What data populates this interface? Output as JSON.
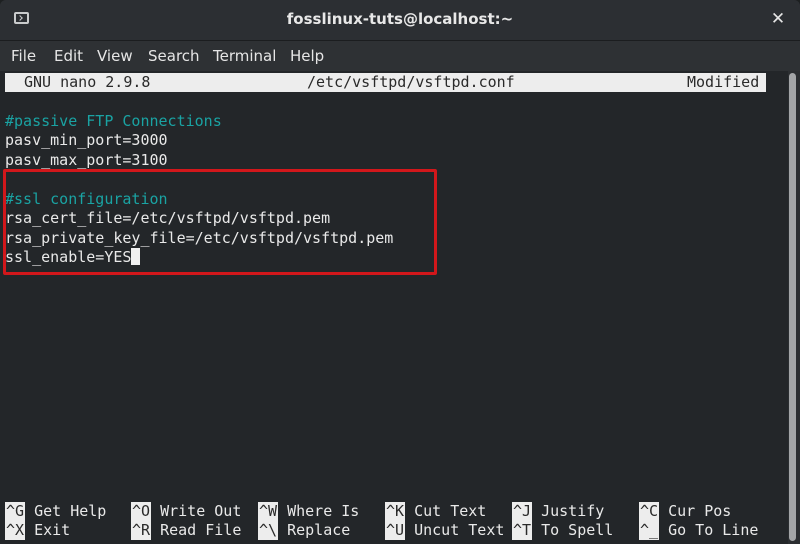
{
  "window": {
    "title": "fosslinux-tuts@localhost:~",
    "icon": "terminal-icon",
    "close_symbol": "✕"
  },
  "menubar": {
    "items": [
      "File",
      "Edit",
      "View",
      "Search",
      "Terminal",
      "Help"
    ]
  },
  "nano": {
    "version": "GNU nano 2.9.8",
    "filename": "/etc/vsftpd/vsftpd.conf",
    "state": "Modified"
  },
  "file_lines": [
    {
      "text": "",
      "type": "blank"
    },
    {
      "text": "#passive FTP Connections",
      "type": "comment"
    },
    {
      "text": "pasv_min_port=3000",
      "type": "code"
    },
    {
      "text": "pasv_max_port=3100",
      "type": "code"
    },
    {
      "text": "",
      "type": "blank"
    },
    {
      "text": "#ssl configuration",
      "type": "comment"
    },
    {
      "text": "rsa_cert_file=/etc/vsftpd/vsftpd.pem",
      "type": "code"
    },
    {
      "text": "rsa_private_key_file=/etc/vsftpd/vsftpd.pem",
      "type": "code"
    },
    {
      "text": "ssl_enable=YES",
      "type": "code"
    }
  ],
  "annotation": {
    "highlight_color": "#d2171b"
  },
  "shortcuts": [
    {
      "key": "^G",
      "label": "Get Help"
    },
    {
      "key": "^O",
      "label": "Write Out"
    },
    {
      "key": "^W",
      "label": "Where Is"
    },
    {
      "key": "^K",
      "label": "Cut Text"
    },
    {
      "key": "^J",
      "label": "Justify"
    },
    {
      "key": "^C",
      "label": "Cur Pos"
    },
    {
      "key": "^X",
      "label": "Exit"
    },
    {
      "key": "^R",
      "label": "Read File"
    },
    {
      "key": "^\\",
      "label": "Replace"
    },
    {
      "key": "^U",
      "label": "Uncut Text"
    },
    {
      "key": "^T",
      "label": "To Spell"
    },
    {
      "key": "^_",
      "label": "Go To Line"
    }
  ],
  "colors": {
    "comment": "#1aa3a3",
    "terminal_bg": "#232629",
    "status_bg": "#ededed"
  }
}
